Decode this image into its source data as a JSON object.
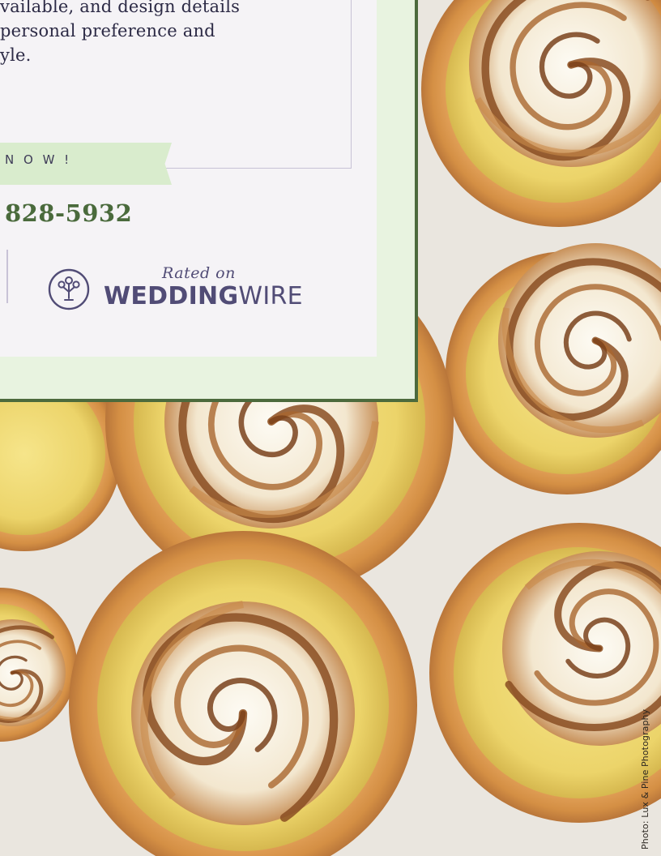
{
  "body_text": "vailable, and design details\n personal preference and\nyle.",
  "cta": {
    "label": "N O W !"
  },
  "contact": {
    "phone": "828-5932"
  },
  "rating": {
    "rated_on": "Rated on",
    "brand_bold": "WEDDING",
    "brand_light": "WIRE",
    "icon": "weddingwire-logo-icon"
  },
  "photo": {
    "credit": "Photo: Lux & Pine Photography",
    "subject": "lemon meringue tarts"
  },
  "colors": {
    "card_green": "#e8f3e0",
    "border_green": "#4c6a3c",
    "phone_green": "#4a6a3c",
    "brand_purple": "#514c76"
  }
}
